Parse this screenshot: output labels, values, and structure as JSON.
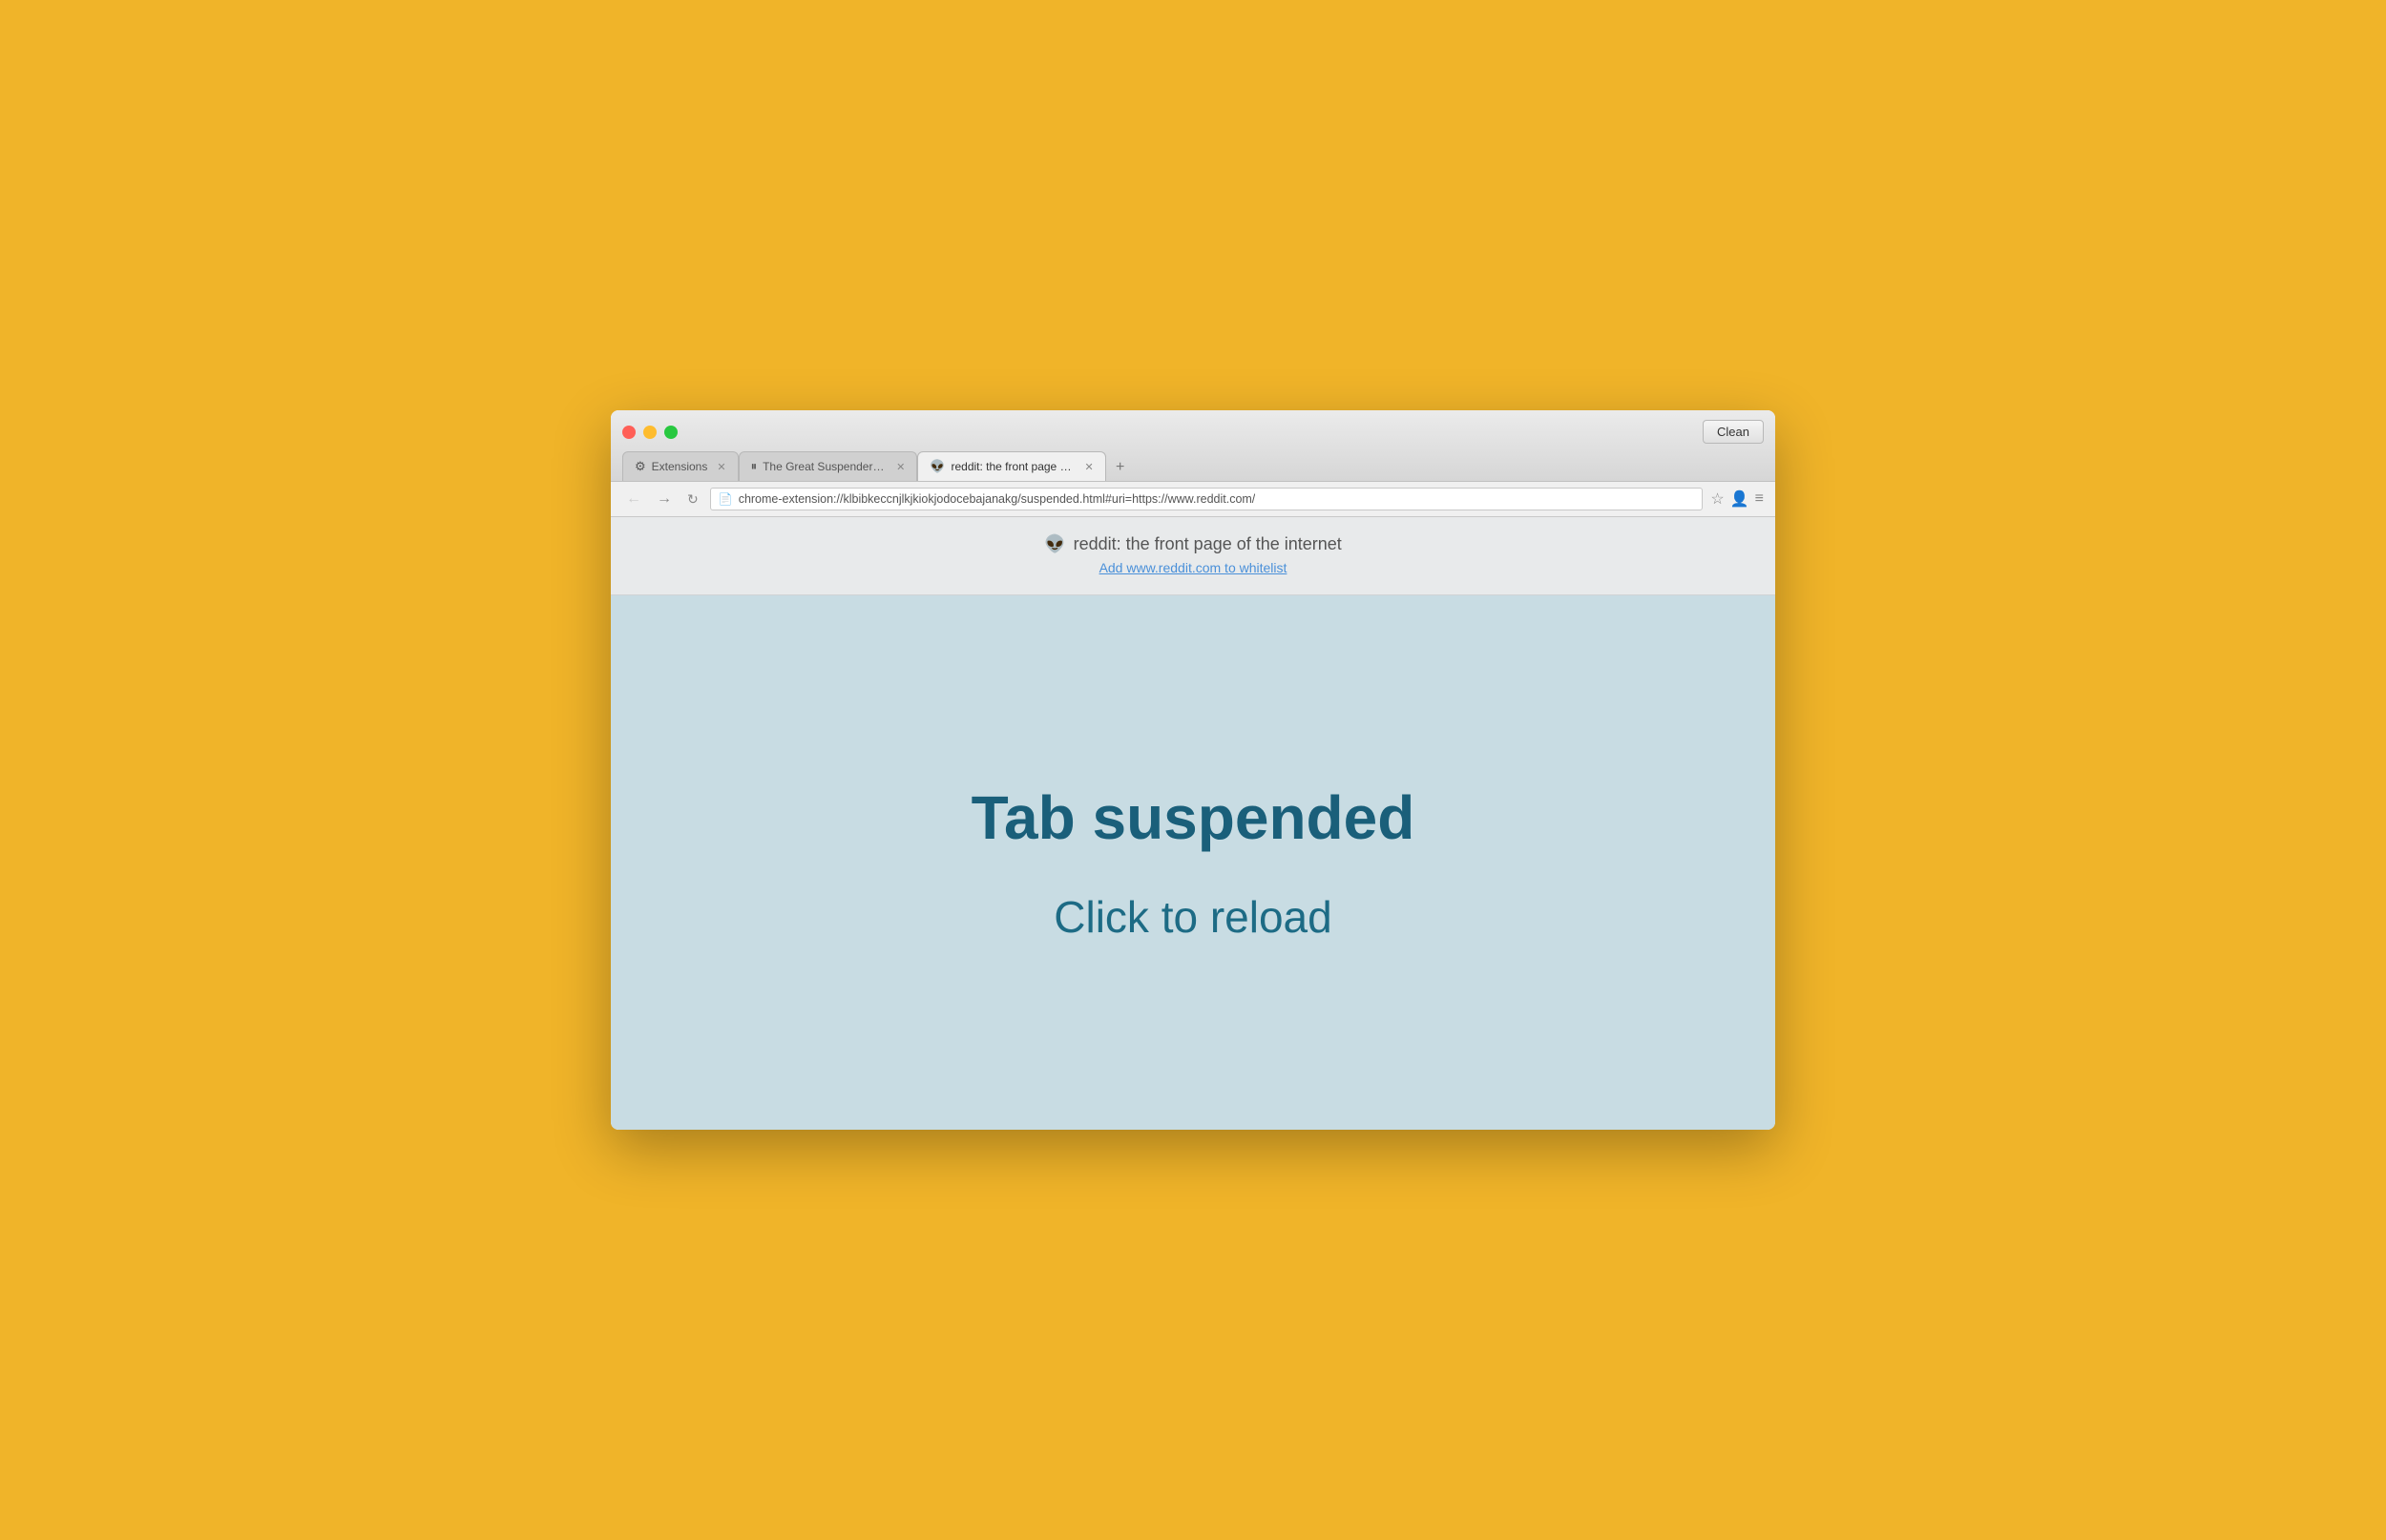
{
  "browser": {
    "clean_button_label": "Clean",
    "window_controls": {
      "close_label": "",
      "minimize_label": "",
      "maximize_label": ""
    }
  },
  "tabs": [
    {
      "id": "extensions-tab",
      "icon": "⚙",
      "label": "Extensions",
      "active": false
    },
    {
      "id": "great-suspender-tab",
      "icon": "⏸",
      "label": "The Great Suspender - Ch…",
      "active": false
    },
    {
      "id": "reddit-tab",
      "icon": "👽",
      "label": "reddit: the front page of th…",
      "active": true
    }
  ],
  "address_bar": {
    "url": "chrome-extension://klbibkeccnjlkjkiokjodocebajanakg/suspended.html#uri=https://www.reddit.com/"
  },
  "page_header": {
    "site_icon": "👽",
    "site_title": "reddit: the front page of the internet",
    "whitelist_link": "Add www.reddit.com to whitelist"
  },
  "suspended_page": {
    "main_text": "Tab suspended",
    "sub_text": "Click to reload"
  }
}
